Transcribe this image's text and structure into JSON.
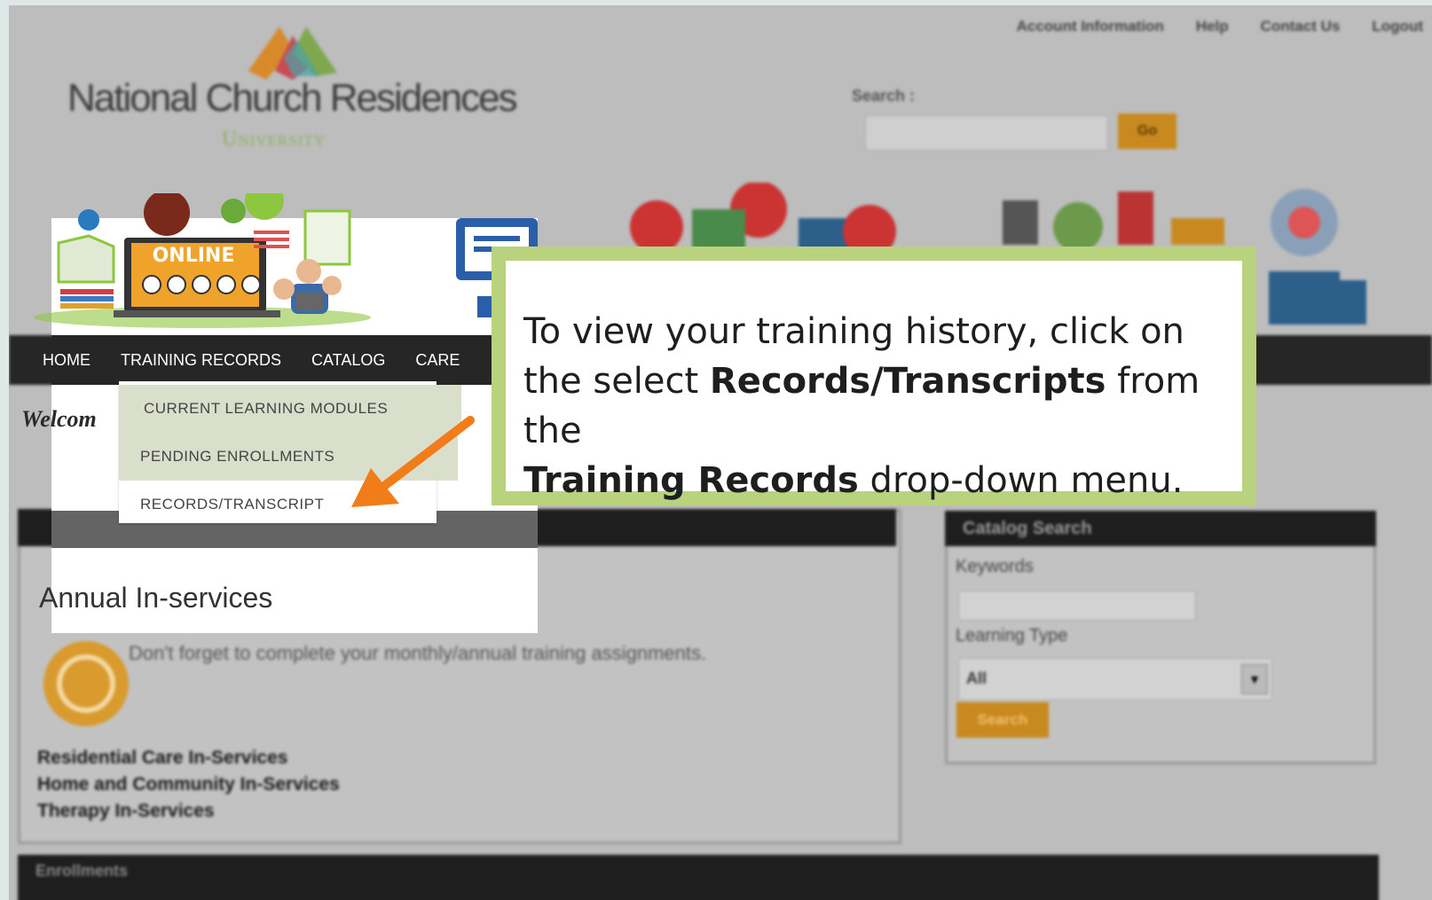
{
  "header": {
    "top_links": [
      "Account Information",
      "Help",
      "Contact Us",
      "Logout"
    ],
    "logo_name": "National Church Residences",
    "logo_sub": "University",
    "search_label": "Search :",
    "search_button": "Go"
  },
  "banner": {
    "online_label": "ONLINE"
  },
  "nav": {
    "home": "HOME",
    "training_records": "TRAINING RECORDS",
    "catalog": "CATALOG",
    "care": "CARE"
  },
  "dropdown": {
    "items": [
      "CURRENT LEARNING MODULES",
      "PENDING ENROLLMENTS",
      "RECORDS/TRANSCRIPT"
    ]
  },
  "main": {
    "welcome": "Welcom",
    "section_title": "Annual In-services",
    "reminder": "Don't forget to complete your monthly/annual training assignments.",
    "links": [
      "Residential Care In-Services",
      "Home and Community In-Services",
      "Therapy In-Services"
    ],
    "enrollments_heading": "Enrollments"
  },
  "catalog_search": {
    "heading": "Catalog Search",
    "keywords_label": "Keywords",
    "learning_type_label": "Learning Type",
    "learning_type_value": "All",
    "search_button": "Search"
  },
  "callout": {
    "part1": "To view your training history, click on the select ",
    "bold1": "Records/Transcripts",
    "part2": " from the ",
    "bold2": "Training Records",
    "part3": " drop-down menu."
  },
  "colors": {
    "callout_border": "#b9d27e",
    "arrow": "#f07d1a",
    "accent": "#c8891e"
  }
}
